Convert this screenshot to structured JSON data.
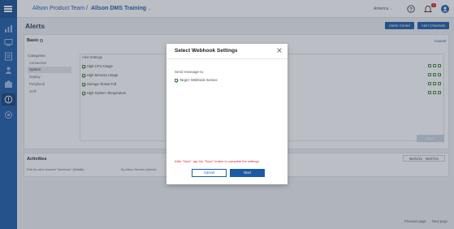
{
  "breadcrumb": {
    "project": "Allson Product Team",
    "separator": "/",
    "current": "Allson DMS Training"
  },
  "topbar": {
    "region": "America",
    "notification_count": "1"
  },
  "page": {
    "title": "Alerts",
    "buttons": [
      "Alerts Center",
      "Alert Channels"
    ]
  },
  "basic": {
    "title": "Basic",
    "cancel": "Cancel"
  },
  "categories": {
    "header": "Categories",
    "items": [
      "Connection",
      "System",
      "Display",
      "Peripheral",
      "SAR"
    ],
    "selected": 1
  },
  "alert_settings": {
    "header": "Alert Settings",
    "items": [
      "High CPU Usage",
      "High Memory Usage",
      "Storage Almost Full",
      "High System Temperature"
    ]
  },
  "save_label": "Save",
  "activities": {
    "title": "Activities",
    "date_range": "05/01/21 - 05/07/21",
    "row_text": "Edit the alert channel \"Webhook\" (",
    "row_link": "Details",
    "row_end": ")",
    "row_by": "By Allson Service (Admin)"
  },
  "pager": {
    "prev": "Previous page",
    "next": "Next page"
  },
  "modal": {
    "title": "Select Webhook Settings",
    "send_label": "Send message to:",
    "target": "Target: Webhook Service",
    "warning": "After \"Next\", tap the \"Save\" button to complete the settings.",
    "cancel": "Cancel",
    "next": "Next"
  },
  "colors": {
    "primary": "#1a5aa6",
    "danger": "#d9262b",
    "success": "#3a8a3a"
  }
}
